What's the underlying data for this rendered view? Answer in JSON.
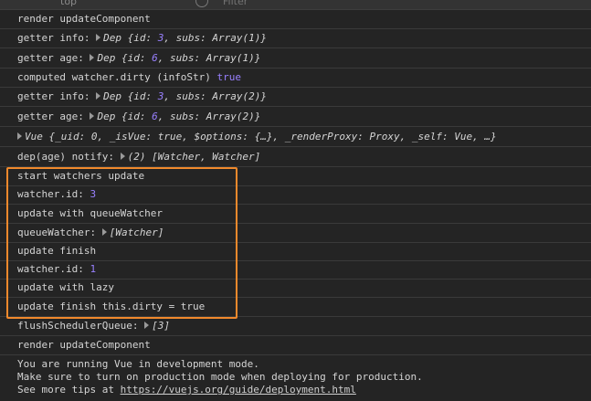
{
  "toolbar": {
    "context": "top",
    "filter_placeholder": "Filter"
  },
  "colors": {
    "highlight": "#f0892c",
    "number": "#9980ff",
    "background": "#242424"
  },
  "rows": {
    "r1": "render updateComponent",
    "r2": {
      "label": "getter info:",
      "obj": "Dep",
      "body_a": "{",
      "k1": "id",
      "v1": "3",
      "k2": "subs",
      "v2": "Array(1)",
      "close": "}"
    },
    "r3": {
      "label": "getter age:",
      "obj": "Dep",
      "body_a": "{",
      "k1": "id",
      "v1": "6",
      "k2": "subs",
      "v2": "Array(1)",
      "close": "}"
    },
    "r4": {
      "label": "computed watcher.dirty (infoStr)",
      "value": "true"
    },
    "r5": {
      "label": "getter info:",
      "obj": "Dep",
      "body_a": "{",
      "k1": "id",
      "v1": "3",
      "k2": "subs",
      "v2": "Array(2)",
      "close": "}"
    },
    "r6": {
      "label": "getter age:",
      "obj": "Dep",
      "body_a": "{",
      "k1": "id",
      "v1": "6",
      "k2": "subs",
      "v2": "Array(2)",
      "close": "}"
    },
    "r7": {
      "obj": "Vue",
      "text": "{_uid: 0, _isVue: true, $options: {…}, _renderProxy: Proxy, _self: Vue, …}"
    },
    "r8": {
      "label": "dep(age) notify:",
      "value": "(2) [Watcher, Watcher]"
    },
    "r9": "start watchers update",
    "r10": {
      "label": "watcher.id:",
      "value": "3"
    },
    "r11": "update with queueWatcher",
    "r12": {
      "label": "queueWatcher:",
      "value": "[Watcher]"
    },
    "r13": "update finish",
    "r14": {
      "label": "watcher.id:",
      "value": "1"
    },
    "r15": "update with lazy",
    "r16": "update finish this.dirty = true",
    "r17": {
      "label": "flushSchedulerQueue:",
      "value": "[3]"
    },
    "r18": "render updateComponent",
    "r19": {
      "line1": "You are running Vue in development mode.",
      "line2": "Make sure to turn on production mode when deploying for production.",
      "line3_prefix": "See more tips at",
      "link": "https://vuejs.org/guide/deployment.html"
    }
  }
}
